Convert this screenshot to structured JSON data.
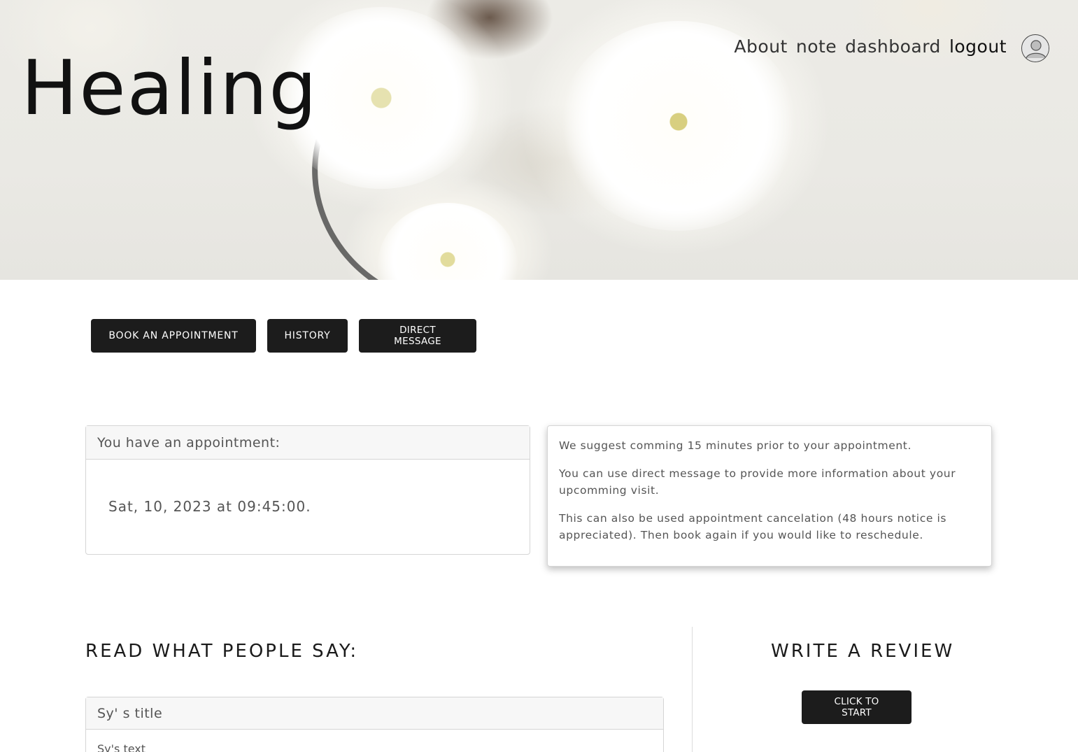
{
  "header": {
    "site_title": "Healing",
    "nav": [
      {
        "label": "About"
      },
      {
        "label": "note"
      },
      {
        "label": "dashboard"
      },
      {
        "label": "logout"
      }
    ]
  },
  "actions": {
    "book_label": "BOOK AN APPOINTMENT",
    "history_label": "HISTORY",
    "direct_message_label": "DIRECT MESSAGE"
  },
  "appointment": {
    "header": "You have an appointment:",
    "datetime": "Sat, 10, 2023 at 09:45:00."
  },
  "info": {
    "p1": "We suggest comming 15 minutes prior to your appointment.",
    "p2": "You can use direct message to provide more information about your upcomming visit.",
    "p3": "This can also be used appointment cancelation (48 hours notice is appreciated). Then book again if you would like to reschedule."
  },
  "reviews": {
    "heading": "READ WHAT PEOPLE SAY:",
    "items": [
      {
        "title": "Sy' s title",
        "text": "Sy's text"
      }
    ]
  },
  "write_review": {
    "heading": "WRITE A REVIEW",
    "button_label": "CLICK TO START"
  },
  "colors": {
    "button_bg": "#1c1c1c",
    "button_text": "#ffffff",
    "card_header_bg": "#f7f7f7"
  },
  "icons": {
    "avatar": "user-avatar-icon"
  }
}
